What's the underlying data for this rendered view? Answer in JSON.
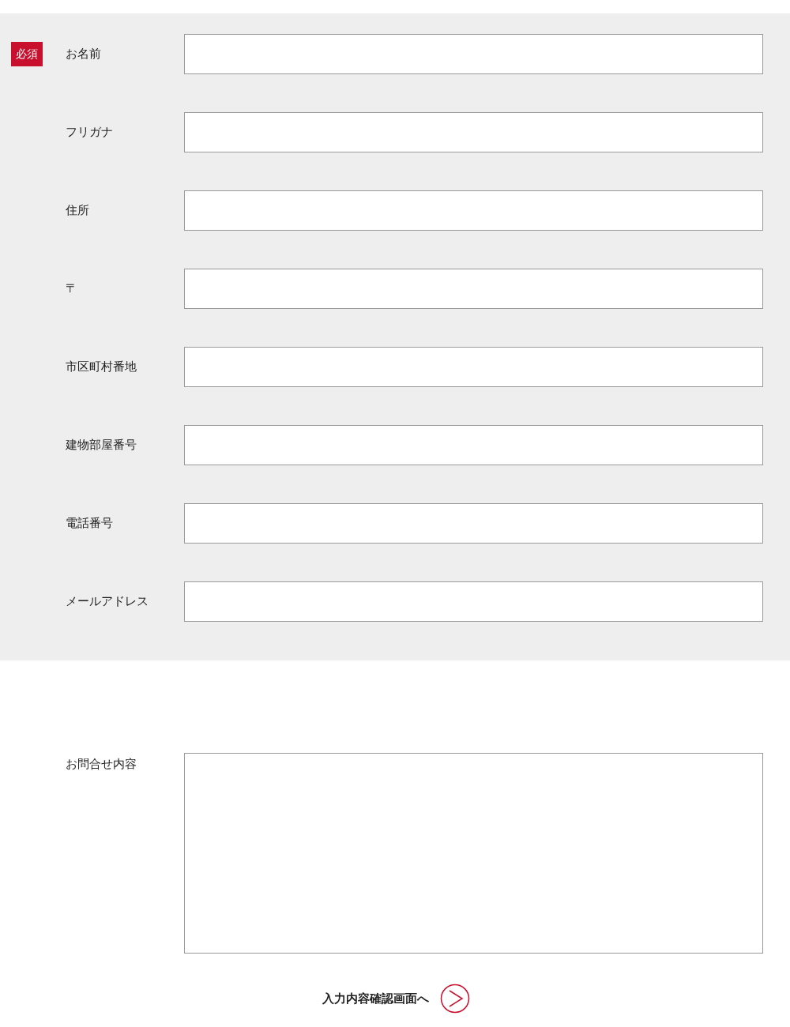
{
  "required_badge": "必須",
  "fields": [
    {
      "label": "お名前",
      "required": true
    },
    {
      "label": "フリガナ",
      "required": false
    },
    {
      "label": "住所",
      "required": false
    },
    {
      "label": "〒",
      "required": false
    },
    {
      "label": "市区町村番地",
      "required": false
    },
    {
      "label": "建物部屋番号",
      "required": false
    },
    {
      "label": "電話番号",
      "required": false
    },
    {
      "label": "メールアドレス",
      "required": false
    }
  ],
  "message": {
    "label": "お問合せ内容"
  },
  "submit": {
    "label": "入力内容確認画面へ"
  }
}
